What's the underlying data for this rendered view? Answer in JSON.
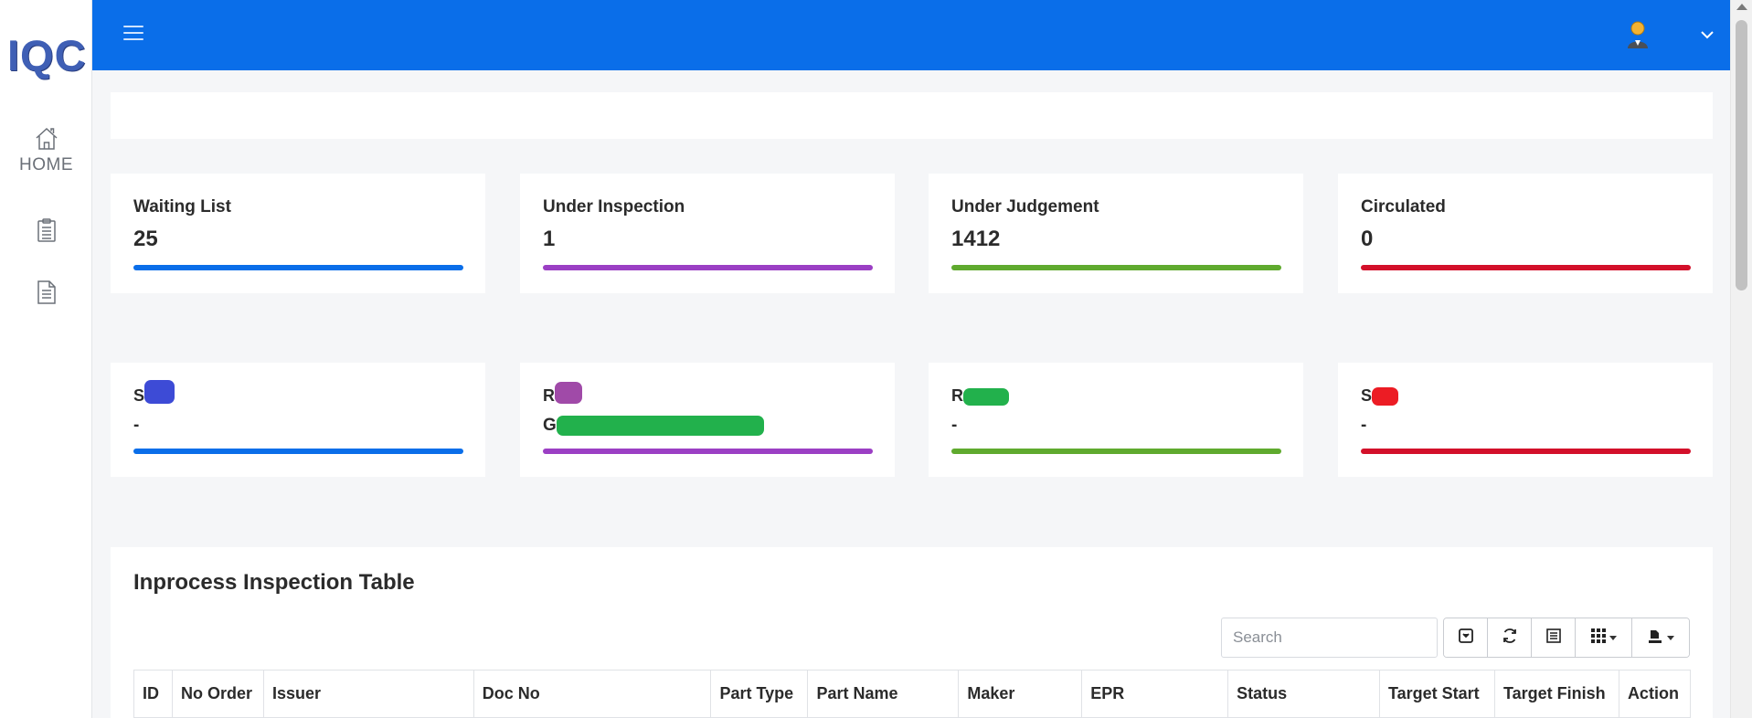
{
  "app": {
    "logo_text": "IQC"
  },
  "sidebar": {
    "items": [
      {
        "label": "HOME",
        "icon": "home-icon"
      },
      {
        "label": "",
        "icon": "clipboard-icon"
      },
      {
        "label": "",
        "icon": "document-icon"
      }
    ]
  },
  "header": {
    "menu_icon": "hamburger-icon",
    "user_icon": "user-avatar-icon",
    "dropdown_icon": "chevron-down-icon"
  },
  "stats_row1": [
    {
      "title": "Waiting List",
      "value": "25",
      "color": "#0a6ee9"
    },
    {
      "title": "Under Inspection",
      "value": "1",
      "color": "#9b3fc4"
    },
    {
      "title": "Under Judgement",
      "value": "1412",
      "color": "#5faa2e"
    },
    {
      "title": "Circulated",
      "value": "0",
      "color": "#d3102a"
    }
  ],
  "stats_row2": [
    {
      "title": "S",
      "value": "-",
      "color": "#0a6ee9"
    },
    {
      "title": "R",
      "value": "G",
      "color": "#9b3fc4"
    },
    {
      "title": "R",
      "value": "-",
      "color": "#5faa2e"
    },
    {
      "title": "S",
      "value": "-",
      "color": "#d3102a"
    }
  ],
  "table": {
    "title": "Inprocess Inspection Table",
    "search_placeholder": "Search",
    "toolbar_icons": [
      "toggle-icon",
      "refresh-icon",
      "list-view-icon",
      "columns-icon",
      "export-icon"
    ],
    "columns": [
      "ID",
      "No Order",
      "Issuer",
      "Doc No",
      "Part Type",
      "Part Name",
      "Maker",
      "EPR",
      "Status",
      "Target Start",
      "Target Finish",
      "Action"
    ]
  }
}
